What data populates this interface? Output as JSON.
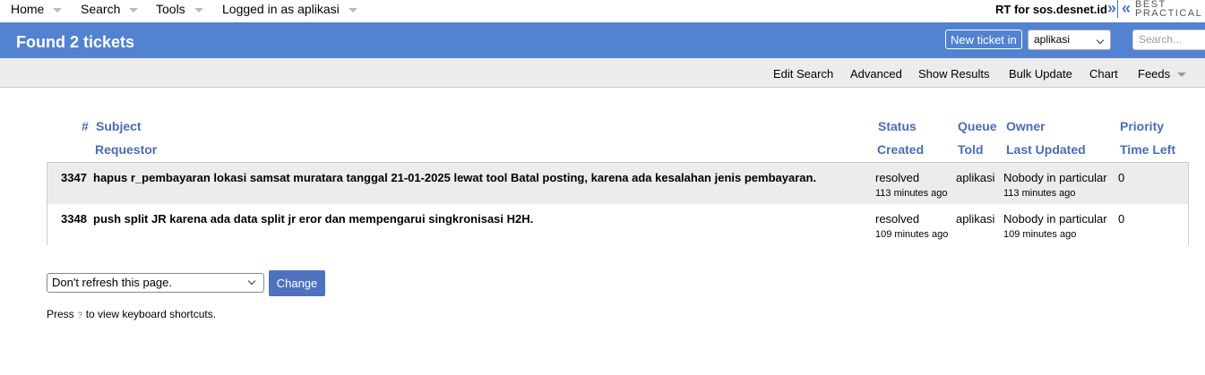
{
  "topnav": {
    "home": "Home",
    "search": "Search",
    "tools": "Tools",
    "logged_in": "Logged in as aplikasi",
    "rt_title": "RT for sos.desnet.id",
    "logo_line1": "BEST",
    "logo_line2": "PRACTICAL"
  },
  "header": {
    "title": "Found 2 tickets",
    "new_ticket_label": "New ticket in",
    "queue_selected": "aplikasi",
    "search_placeholder": "Search..."
  },
  "pagemenu": {
    "edit_search": "Edit Search",
    "advanced": "Advanced",
    "show_results": "Show Results",
    "bulk_update": "Bulk Update",
    "chart": "Chart",
    "feeds": "Feeds"
  },
  "table": {
    "headers_row1": {
      "id": "#",
      "subject": "Subject",
      "status": "Status",
      "queue": "Queue",
      "owner": "Owner",
      "priority": "Priority"
    },
    "headers_row2": {
      "requestor": "Requestor",
      "created": "Created",
      "told": "Told",
      "last_updated": "Last Updated",
      "time_left": "Time Left"
    },
    "rows": [
      {
        "id": "3347",
        "subject": "hapus r_pembayaran lokasi samsat muratara tanggal 21-01-2025 lewat tool Batal posting, karena ada kesalahan jenis pembayaran.",
        "status": "resolved",
        "queue": "aplikasi",
        "owner": "Nobody in particular",
        "priority": "0",
        "created": "113 minutes ago",
        "last_updated": "113 minutes ago"
      },
      {
        "id": "3348",
        "subject": "push split JR karena ada data split jr eror dan mempengarui singkronisasi H2H.",
        "status": "resolved",
        "queue": "aplikasi",
        "owner": "Nobody in particular",
        "priority": "0",
        "created": "109 minutes ago",
        "last_updated": "109 minutes ago"
      }
    ]
  },
  "refresh": {
    "selected": "Don't refresh this page.",
    "change_label": "Change"
  },
  "shortcuts": {
    "prefix": "Press",
    "key": "?",
    "suffix": "to view keyboard shortcuts."
  },
  "colors": {
    "header_blue": "#5282d0",
    "link_blue": "#4a6db5",
    "button_blue": "#4f72c0"
  }
}
